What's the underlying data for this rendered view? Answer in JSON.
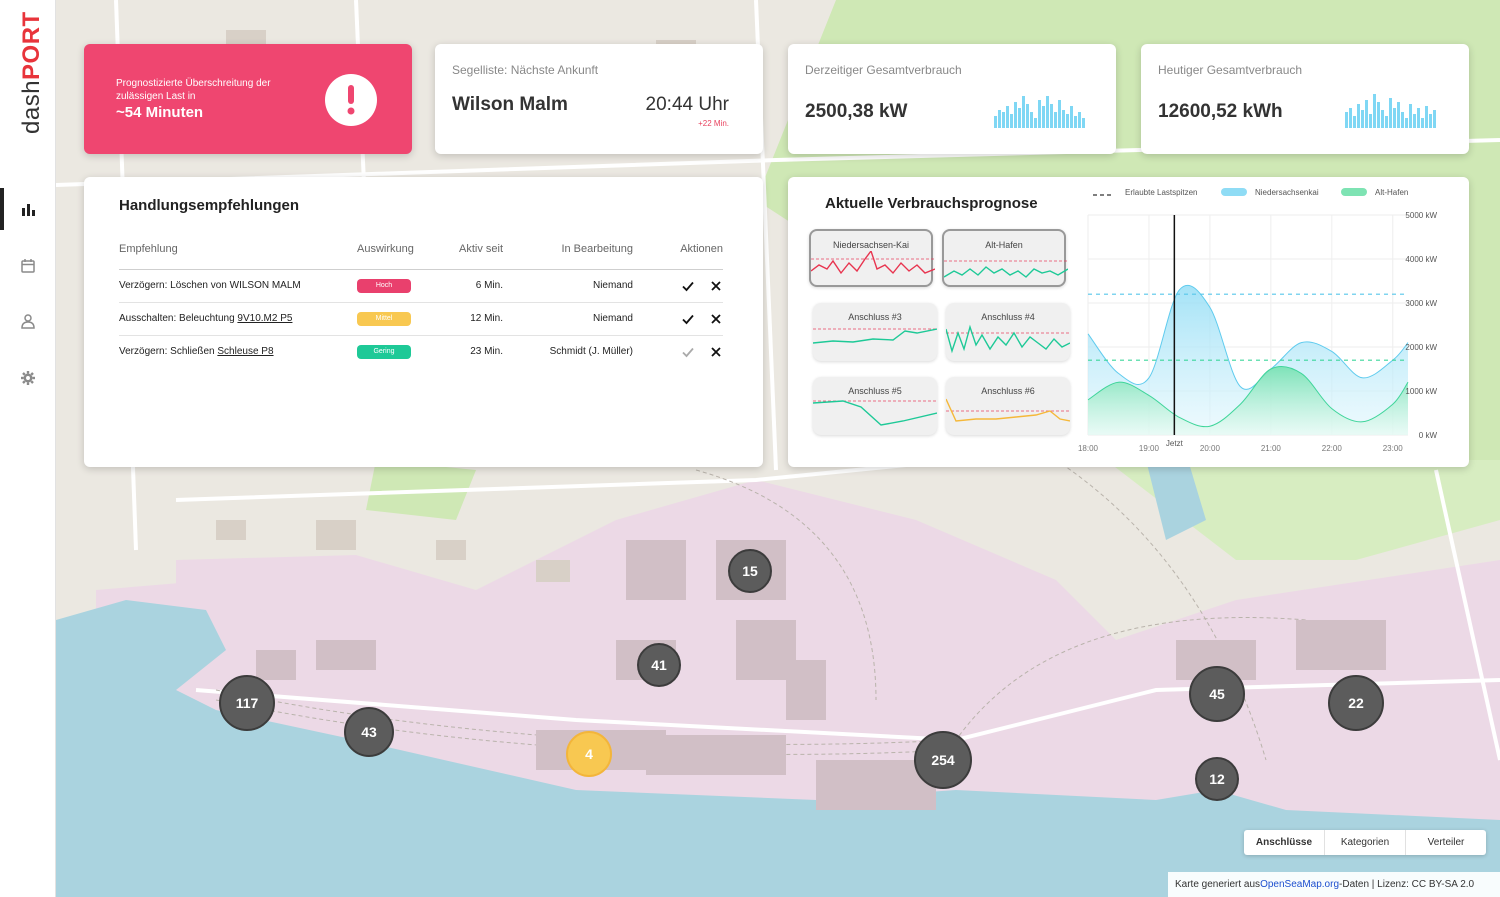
{
  "app": {
    "logo_light": "dash",
    "logo_bold": "PORT"
  },
  "nav": [
    {
      "icon": "bar-chart-icon",
      "active": true
    },
    {
      "icon": "calendar-icon",
      "active": false
    },
    {
      "icon": "user-icon",
      "active": false
    },
    {
      "icon": "gear-icon",
      "active": false
    }
  ],
  "alert": {
    "text": "Prognostizierte Überschreitung der zulässigen Last in",
    "value": "~54 Minuten",
    "color": "#ef4670"
  },
  "arrival": {
    "label": "Segelliste: Nächste Ankunft",
    "ship": "Wilson Malm",
    "time": "20:44 Uhr",
    "delay": "+22 Min."
  },
  "current": {
    "label": "Derzeitiger Gesamtverbrauch",
    "value": "2500,38 kW"
  },
  "today": {
    "label": "Heutiger Gesamtverbrauch",
    "value": "12600,52 kWh"
  },
  "recommendations": {
    "title": "Handlungsempfehlungen",
    "headers": {
      "rec": "Empfehlung",
      "impact": "Auswirkung",
      "since": "Aktiv seit",
      "owner": "In Bearbeitung",
      "actions": "Aktionen"
    },
    "rows": [
      {
        "text": "Verzögern: Löschen von WILSON MALM",
        "link": "",
        "impact": "Hoch",
        "since": "6 Min.",
        "owner": "Niemand"
      },
      {
        "text": "Ausschalten: Beleuchtung ",
        "link": "9V10.M2 P5",
        "impact": "Mittel",
        "since": "12 Min.",
        "owner": "Niemand"
      },
      {
        "text": "Verzögern: Schließen ",
        "link": "Schleuse P8",
        "impact": "Gering",
        "since": "23 Min.",
        "owner": "Schmidt (J. Müller)"
      }
    ]
  },
  "forecast": {
    "title": "Aktuelle Verbrauchsprognose",
    "minis": [
      "Niedersachsen-Kai",
      "Alt-Hafen",
      "Anschluss #3",
      "Anschluss #4",
      "Anschluss #5",
      "Anschluss #6"
    ],
    "legend": {
      "limit": "Erlaubte Lastspitzen",
      "s1": "Niedersachsenkai",
      "s2": "Alt-Hafen"
    },
    "now_label": "Jetzt"
  },
  "chart_data": {
    "type": "area",
    "x": [
      "18:00",
      "18:30",
      "19:00",
      "19:30",
      "20:00",
      "20:30",
      "21:00",
      "21:30",
      "22:00",
      "22:30",
      "23:00",
      "23:15"
    ],
    "yticks": [
      "5000 kW",
      "4000 kW",
      "3000 kW",
      "2000 kW",
      "1000 kW",
      "0 kW"
    ],
    "xticks": [
      "18:00",
      "19:00",
      "20:00",
      "21:00",
      "22:00",
      "23:00"
    ],
    "ylim": [
      0,
      5000
    ],
    "series": [
      {
        "name": "Niedersachsenkai",
        "color": "#8fdcf5",
        "values": [
          2300,
          1400,
          1300,
          3300,
          2900,
          1100,
          1500,
          2100,
          1900,
          1300,
          1700,
          2100
        ]
      },
      {
        "name": "Alt-Hafen",
        "color": "#7ee3b3",
        "values": [
          800,
          1200,
          900,
          400,
          200,
          700,
          1500,
          1400,
          600,
          300,
          700,
          1200
        ]
      }
    ],
    "limits": [
      {
        "series": "Niedersachsenkai",
        "value": 3200,
        "color": "#57c6ea"
      },
      {
        "series": "Alt-Hafen",
        "value": 1700,
        "color": "#3cd69b"
      }
    ],
    "now": "19:25"
  },
  "clusters": [
    {
      "label": "15",
      "color": "gray"
    },
    {
      "label": "41",
      "color": "gray"
    },
    {
      "label": "117",
      "color": "gray"
    },
    {
      "label": "43",
      "color": "gray"
    },
    {
      "label": "4",
      "color": "yellow"
    },
    {
      "label": "254",
      "color": "gray"
    },
    {
      "label": "45",
      "color": "gray"
    },
    {
      "label": "22",
      "color": "gray"
    },
    {
      "label": "12",
      "color": "gray"
    }
  ],
  "map_tabs": [
    "Anschlüsse",
    "Kategorien",
    "Verteiler"
  ],
  "attribution": {
    "prefix": "Karte generiert aus ",
    "link": "OpenSeaMap.org",
    "suffix": "-Daten | Lizenz: CC BY-SA 2.0"
  }
}
